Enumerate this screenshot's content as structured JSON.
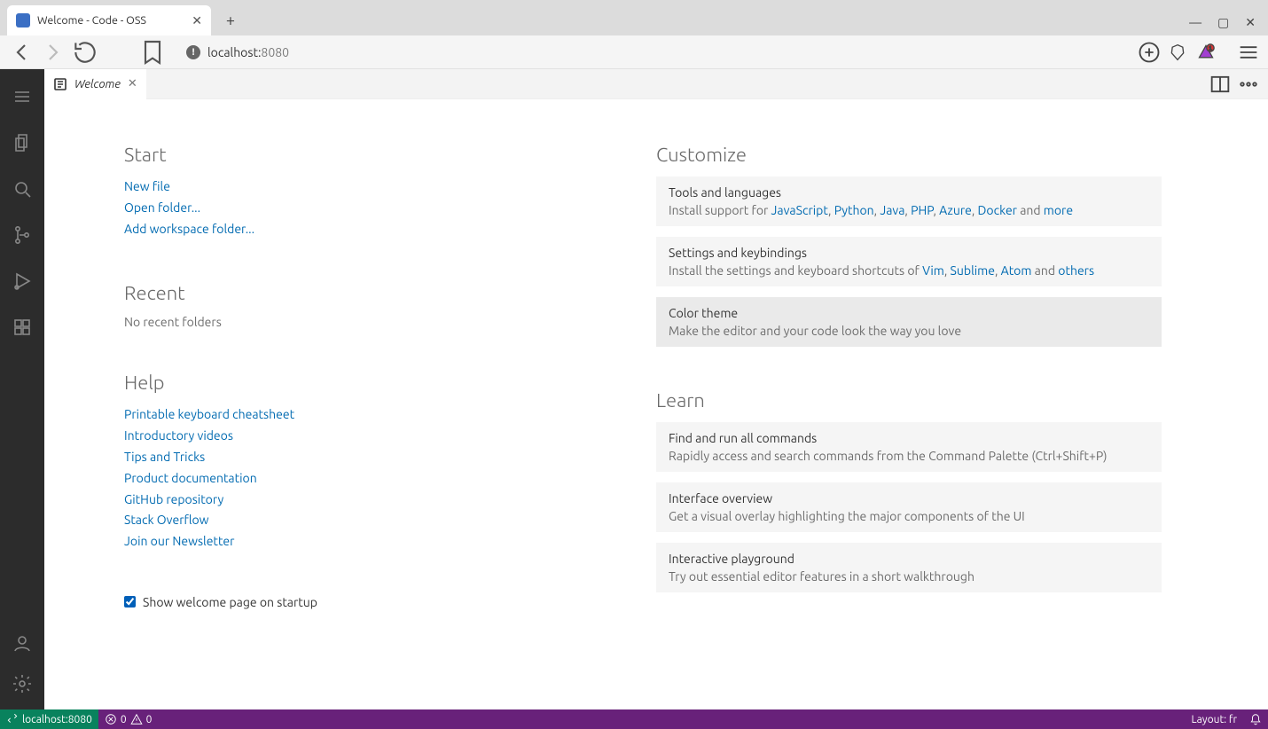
{
  "browser": {
    "tab_title": "Welcome - Code - OSS",
    "address_host": "localhost:",
    "address_port": "8080"
  },
  "editor_tab": {
    "label": "Welcome"
  },
  "welcome": {
    "start": {
      "heading": "Start",
      "new_file": "New file",
      "open_folder": "Open folder...",
      "add_workspace": "Add workspace folder..."
    },
    "recent": {
      "heading": "Recent",
      "empty": "No recent folders"
    },
    "help": {
      "heading": "Help",
      "links": [
        "Printable keyboard cheatsheet",
        "Introductory videos",
        "Tips and Tricks",
        "Product documentation",
        "GitHub repository",
        "Stack Overflow",
        "Join our Newsletter"
      ]
    },
    "startup_label": "Show welcome page on startup",
    "customize": {
      "heading": "Customize",
      "tools": {
        "title": "Tools and languages",
        "prefix": "Install support for ",
        "links": [
          "JavaScript",
          "Python",
          "Java",
          "PHP",
          "Azure",
          "Docker"
        ],
        "and": " and ",
        "more": "more"
      },
      "settings": {
        "title": "Settings and keybindings",
        "prefix": "Install the settings and keyboard shortcuts of ",
        "links": [
          "Vim",
          "Sublime",
          "Atom"
        ],
        "and": " and ",
        "others": "others"
      },
      "theme": {
        "title": "Color theme",
        "desc": "Make the editor and your code look the way you love"
      }
    },
    "learn": {
      "heading": "Learn",
      "cmd": {
        "title": "Find and run all commands",
        "desc": "Rapidly access and search commands from the Command Palette (Ctrl+Shift+P)"
      },
      "overview": {
        "title": "Interface overview",
        "desc": "Get a visual overlay highlighting the major components of the UI"
      },
      "playground": {
        "title": "Interactive playground",
        "desc": "Try out essential editor features in a short walkthrough"
      }
    }
  },
  "statusbar": {
    "remote": "localhost:8080",
    "errors": "0",
    "warnings": "0",
    "layout": "Layout: fr"
  }
}
